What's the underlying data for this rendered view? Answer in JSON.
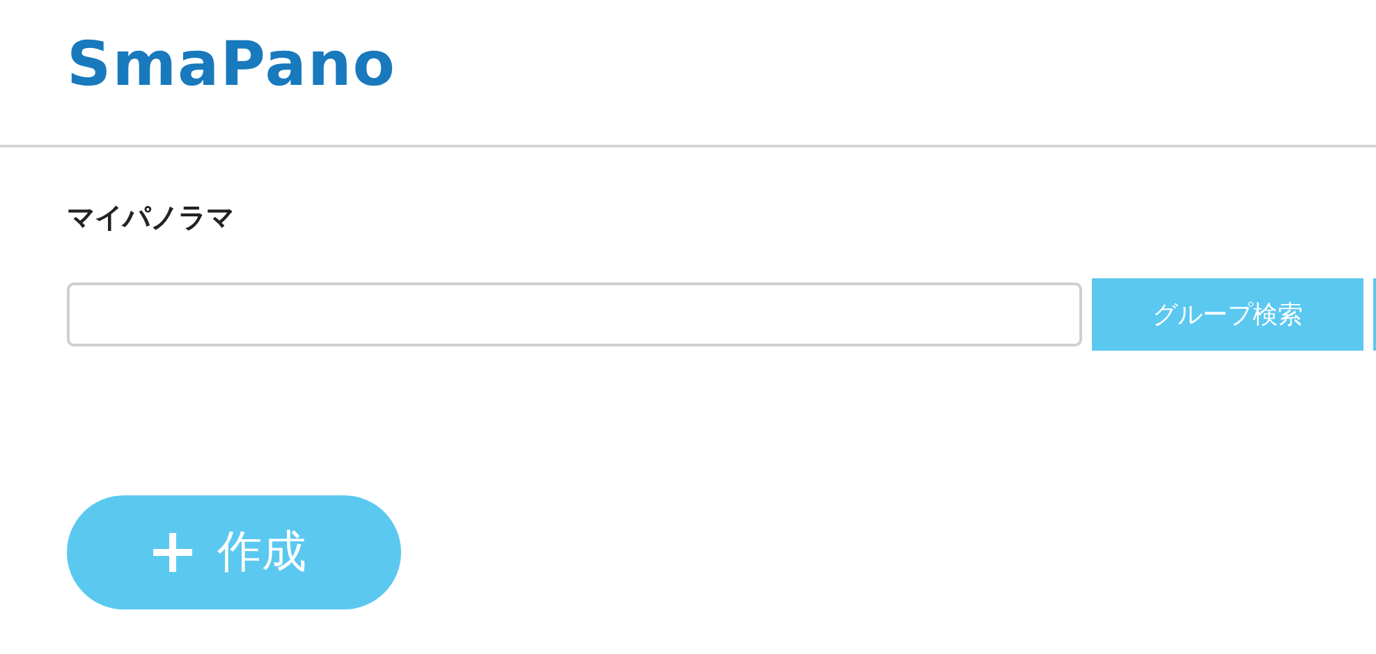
{
  "header": {
    "logo": "SmaPano"
  },
  "page_title": "マイパノラマ",
  "search": {
    "button": "グループ検索"
  },
  "create_button": {
    "label": "作成"
  }
}
